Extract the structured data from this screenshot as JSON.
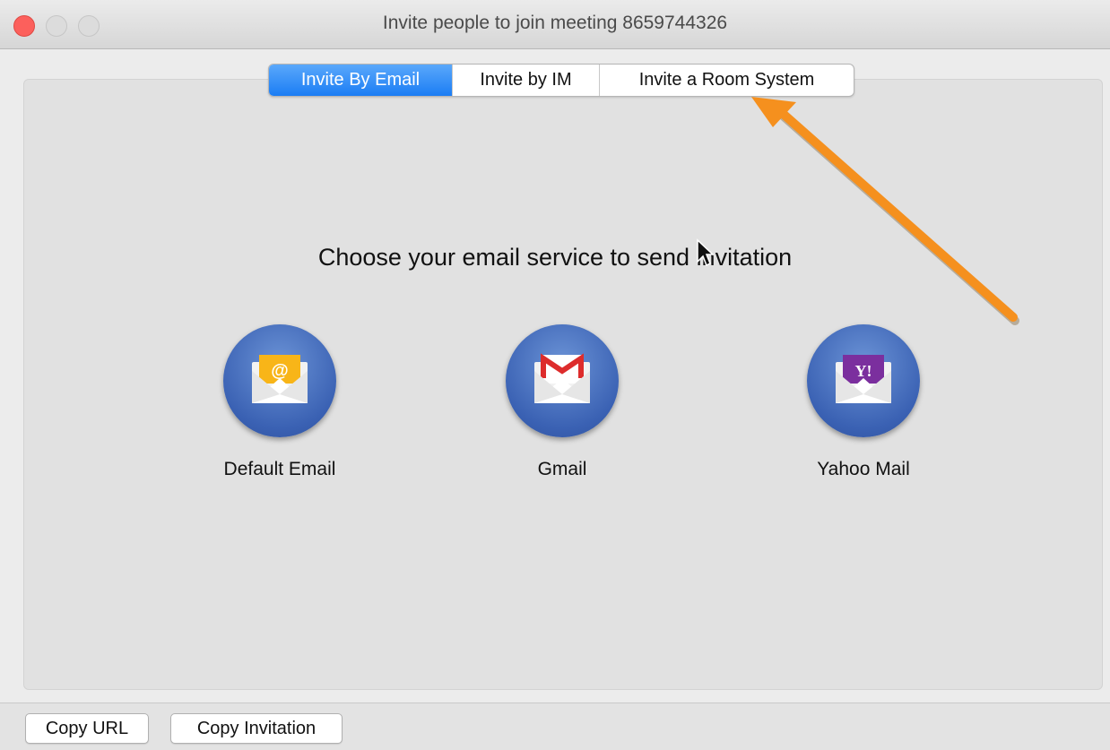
{
  "window": {
    "title": "Invite people to join meeting 8659744326"
  },
  "tabs": [
    {
      "label": "Invite By Email",
      "active": true
    },
    {
      "label": "Invite by IM",
      "active": false
    },
    {
      "label": "Invite a Room System",
      "active": false
    }
  ],
  "main": {
    "heading": "Choose your email service to send invitation",
    "services": [
      {
        "label": "Default Email",
        "icon": "default-email-icon"
      },
      {
        "label": "Gmail",
        "icon": "gmail-icon"
      },
      {
        "label": "Yahoo Mail",
        "icon": "yahoo-mail-icon"
      }
    ]
  },
  "footer": {
    "copy_url": "Copy URL",
    "copy_invitation": "Copy Invitation"
  },
  "colors": {
    "accent": "#1b7df4",
    "annotation_arrow": "#f5901e",
    "close": "#fc605c"
  }
}
